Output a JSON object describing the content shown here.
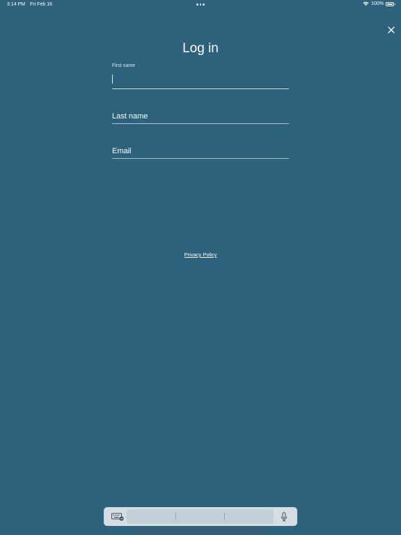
{
  "status_bar": {
    "time": "3:14 PM",
    "date": "Fri Feb 16",
    "battery": "100%",
    "battery_level": 1.0
  },
  "icons": {
    "close": "close-icon",
    "wifi": "wifi-icon",
    "battery": "battery-icon",
    "keyboard": "keyboard-icon",
    "mic": "microphone-icon"
  },
  "title": "Log in",
  "form": {
    "first_name": {
      "label": "First name",
      "value": ""
    },
    "last_name": {
      "placeholder": "Last name",
      "value": ""
    },
    "email": {
      "placeholder": "Email",
      "value": ""
    }
  },
  "privacy_link": "Privacy Policy",
  "colors": {
    "background": "#2d627d",
    "text": "#ffffff",
    "keyboard_bar": "#d6dde2"
  }
}
